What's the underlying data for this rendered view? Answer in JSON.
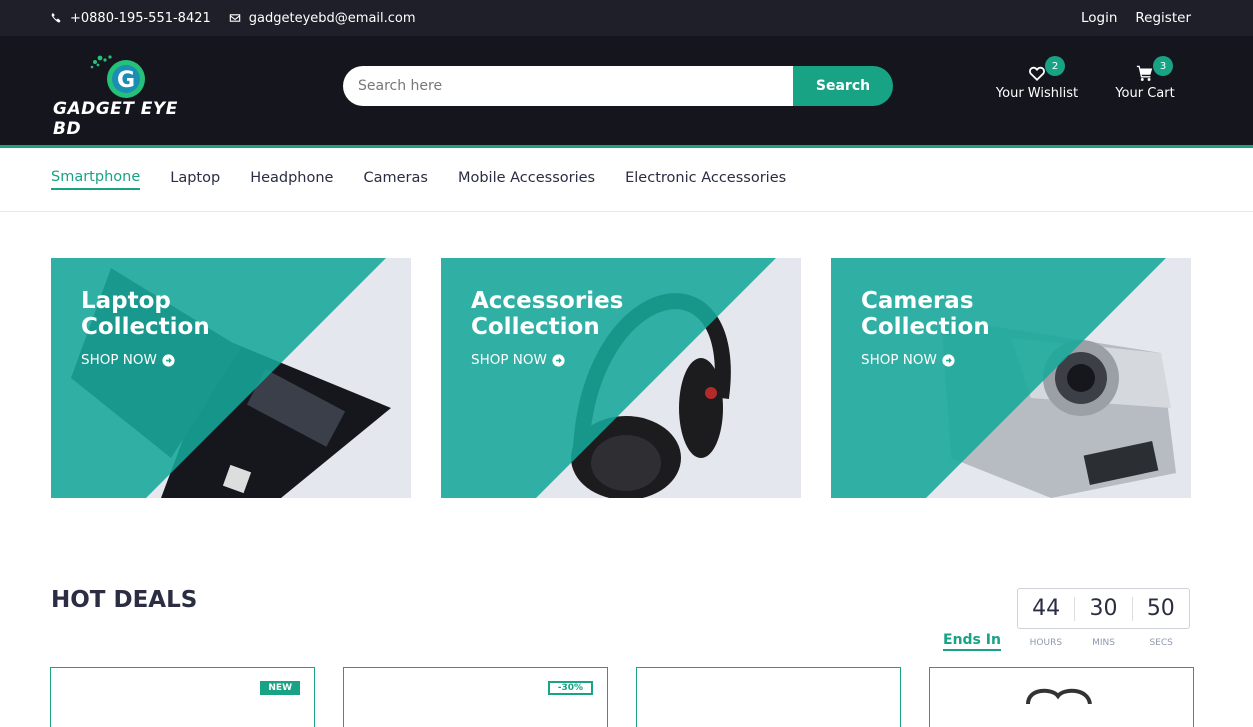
{
  "topbar": {
    "phone": "+0880-195-551-8421",
    "email": "gadgeteyebd@email.com",
    "login_label": "Login",
    "register_label": "Register"
  },
  "header": {
    "brand_name": "GADGET EYE BD",
    "search_placeholder": "Search here",
    "search_button_label": "Search",
    "wishlist_label": "Your Wishlist",
    "wishlist_count": "2",
    "cart_label": "Your Cart",
    "cart_count": "3"
  },
  "nav": {
    "items": [
      {
        "label": "Smartphone"
      },
      {
        "label": "Laptop"
      },
      {
        "label": "Headphone"
      },
      {
        "label": "Cameras"
      },
      {
        "label": "Mobile Accessories"
      },
      {
        "label": "Electronic Accessories"
      }
    ],
    "active": "Smartphone"
  },
  "collections": [
    {
      "title_line1": "Laptop",
      "title_line2": "Collection",
      "cta": "SHOP NOW"
    },
    {
      "title_line1": "Accessories",
      "title_line2": "Collection",
      "cta": "SHOP NOW"
    },
    {
      "title_line1": "Cameras",
      "title_line2": "Collection",
      "cta": "SHOP NOW"
    }
  ],
  "hot_deals": {
    "title": "HOT DEALS",
    "ends_in_label": "Ends In",
    "timer": {
      "hours": "44",
      "mins": "30",
      "secs": "50",
      "hours_label": "HOURS",
      "mins_label": "MINS",
      "secs_label": "SECS"
    },
    "products": [
      {
        "tag": "NEW"
      },
      {
        "tag": "-30%"
      },
      {
        "tag": ""
      },
      {
        "tag": ""
      }
    ]
  },
  "colors": {
    "accent": "#17a384",
    "topbar_bg": "#1e1f29",
    "header_bg": "#15161d"
  }
}
